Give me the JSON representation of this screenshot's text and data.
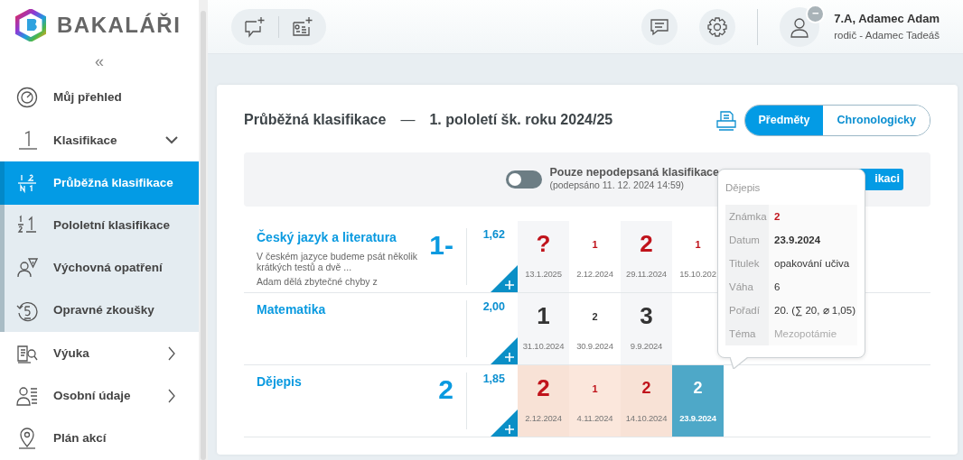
{
  "brand": {
    "name": "BAKALÁŘI"
  },
  "sidebar": {
    "collapse": "«",
    "items": [
      {
        "label": "Můj přehled",
        "kind": "link",
        "selected": false
      },
      {
        "label": "Klasifikace",
        "kind": "group",
        "selected": false,
        "expanded": true,
        "children": [
          {
            "label": "Průběžná klasifikace",
            "selected": true
          },
          {
            "label": "Pololetní klasifikace",
            "selected": false
          },
          {
            "label": "Výchovná opatření",
            "selected": false
          },
          {
            "label": "Opravné zkoušky",
            "selected": false
          }
        ]
      },
      {
        "label": "Výuka",
        "kind": "group",
        "selected": false,
        "expanded": false
      },
      {
        "label": "Osobní údaje",
        "kind": "group",
        "selected": false,
        "expanded": false
      },
      {
        "label": "Plán akcí",
        "kind": "link",
        "selected": false
      }
    ]
  },
  "user": {
    "name": "7.A, Adamec Adam",
    "role": "rodič - Adamec Tadeáš",
    "badge": "−"
  },
  "page": {
    "title": "Průběžná klasifikace",
    "dash": "—",
    "period": "1. pololetí šk. roku 2024/25",
    "views": [
      {
        "label": "Předměty",
        "selected": true
      },
      {
        "label": "Chronologicky",
        "selected": false
      }
    ]
  },
  "filter": {
    "toggle_on": false,
    "label": "Pouze nepodepsaná klasifikace",
    "note": "(podepsáno 11. 12. 2024 14:59)",
    "button": "ikaci"
  },
  "subjects": [
    {
      "name": "Český jazyk a literatura",
      "final": "1-",
      "average": "1,62",
      "highlighted": false,
      "notes": [
        "V českém jazyce budeme psát několik krátkých testů a dvě ...",
        "Adam dělá zbytečné chyby z"
      ],
      "grades": [
        {
          "grade": "?",
          "kind": "large",
          "color": "#c0131b",
          "date": "13.1.2025",
          "selected": false
        },
        {
          "grade": "1",
          "kind": "small",
          "color": "#c0131b",
          "date": "2.12.2024",
          "selected": false
        },
        {
          "grade": "2",
          "kind": "large",
          "color": "#c0131b",
          "date": "29.11.2024",
          "selected": false
        },
        {
          "grade": "1",
          "kind": "small",
          "color": "#c0131b",
          "date": "15.10.202",
          "selected": false
        }
      ]
    },
    {
      "name": "Matematika",
      "average": "2,00",
      "highlighted": false,
      "grades": [
        {
          "grade": "1",
          "kind": "large",
          "color": "#333333",
          "date": "31.10.2024",
          "selected": false
        },
        {
          "grade": "2",
          "kind": "small",
          "color": "#333333",
          "date": "30.9.2024",
          "selected": false
        },
        {
          "grade": "3",
          "kind": "large",
          "color": "#333333",
          "date": "9.9.2024",
          "selected": false
        }
      ]
    },
    {
      "name": "Dějepis",
      "final": "2",
      "average": "1,85",
      "highlighted": true,
      "grades": [
        {
          "grade": "2",
          "kind": "large",
          "color": "#c0131b",
          "date": "2.12.2024",
          "selected": false
        },
        {
          "grade": "1",
          "kind": "small",
          "color": "#c0131b",
          "date": "4.11.2024",
          "selected": false
        },
        {
          "grade": "2",
          "kind": "medium",
          "color": "#c0131b",
          "date": "14.10.2024",
          "selected": false
        },
        {
          "grade": "2",
          "kind": "medium",
          "date": "23.9.2024",
          "selected": true
        }
      ]
    }
  ],
  "tooltip": {
    "title": "Dějepis",
    "rows": [
      {
        "label": "Známka",
        "value": "2",
        "kind": "grade"
      },
      {
        "label": "Datum",
        "value": "23.9.2024",
        "kind": "bold"
      },
      {
        "label": "Titulek",
        "value": "opakování učiva",
        "kind": "plain"
      },
      {
        "label": "Váha",
        "value": "6",
        "kind": "plain"
      },
      {
        "label": "Pořadí",
        "value": "20. (∑ 20, ⌀ 1,05)",
        "kind": "plain"
      },
      {
        "label": "Téma",
        "value": "Mezopotámie",
        "kind": "muted"
      }
    ]
  }
}
